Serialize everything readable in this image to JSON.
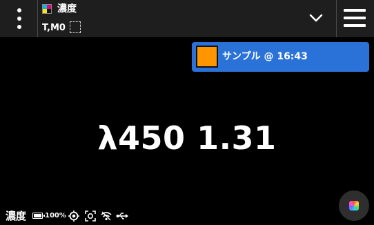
{
  "header": {
    "menu_icon": "kebab-menu-icon",
    "mode_icon": "cmyk-density-icon",
    "mode_colors": [
      "#00b7eb",
      "#e6007e",
      "#ffe600",
      "#111111"
    ],
    "mode_title": "濃度",
    "mode_sub": "T,M0",
    "selection_icon": "dashed-selection-icon",
    "dropdown_icon": "chevron-down-icon",
    "hamburger_icon": "hamburger-menu-icon"
  },
  "sample": {
    "swatch_color": "#ff9500",
    "label": "サンプル @ 16:43",
    "accent": "#2a72d8"
  },
  "reading": {
    "value": "λ450 1.31"
  },
  "status": {
    "title": "濃度",
    "battery_level": 1.0,
    "battery_label": "100%",
    "icons": [
      "target-icon",
      "aperture-icon",
      "wifi-icon",
      "usb-icon"
    ]
  },
  "fab": {
    "icon": "color-palette-icon"
  }
}
